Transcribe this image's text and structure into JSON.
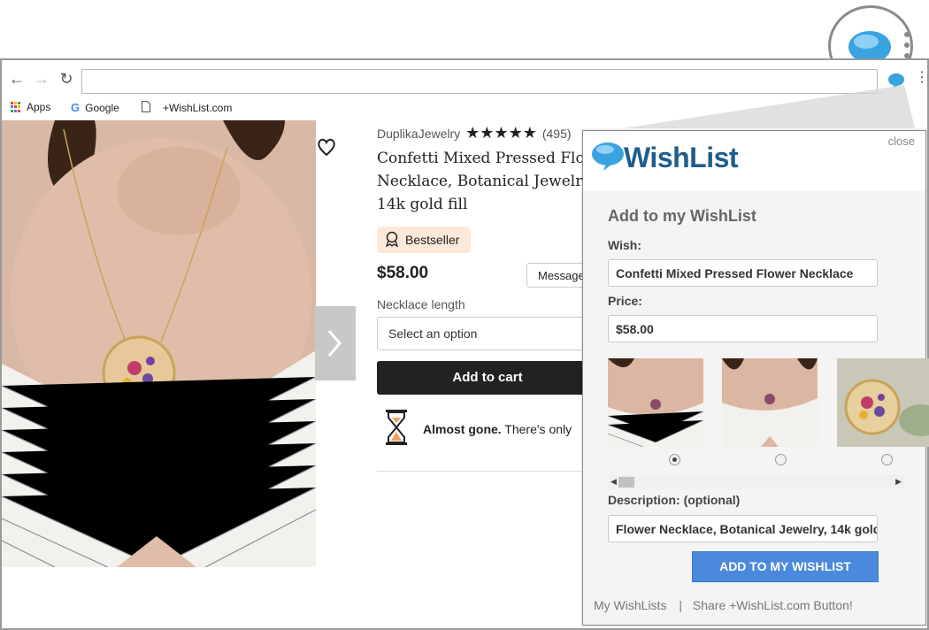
{
  "browser": {
    "bookmarks": {
      "apps": "Apps",
      "google": "Google",
      "wishlist": "+WishList.com"
    }
  },
  "product": {
    "shop_name": "DuplikaJewelry",
    "stars": "★★★★★",
    "reviews": "(495)",
    "title_lines": [
      "Confetti Mixed Pressed Flo",
      "Necklace, Botanical Jewelr",
      "14k gold fill"
    ],
    "badge": "Bestseller",
    "price": "$58.00",
    "message_button": "Message",
    "necklace_label": "Necklace length",
    "select_placeholder": "Select an option",
    "add_to_cart": "Add to cart",
    "stock_bold": "Almost gone.",
    "stock_rest": " There's only"
  },
  "popup": {
    "close": "close",
    "logo_text": "WishList",
    "title": "Add to my WishList",
    "wish_label": "Wish:",
    "wish_value": "Confetti Mixed Pressed Flower Necklace",
    "price_label": "Price:",
    "price_value": "$58.00",
    "description_label": "Description: (optional)",
    "description_value": "Flower Necklace, Botanical Jewelry, 14k gold",
    "add_button": "ADD TO MY WISHLIST",
    "footer_my": "My WishLists",
    "footer_sep": "|",
    "footer_share": "Share +WishList.com Button!",
    "selected_image_index": 0
  },
  "colors": {
    "wishlist_blue": "#1f5d8c",
    "button_blue": "#4a89dc",
    "badge_bg": "#fde9d9"
  }
}
